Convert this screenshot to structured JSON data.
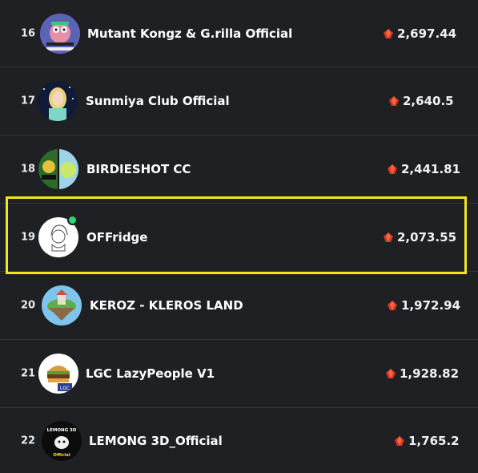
{
  "colors": {
    "background": "#1f2024",
    "divider": "#34363c",
    "highlight": "#f5e61c",
    "online": "#2fd673",
    "volume_icon": "#d9342b"
  },
  "volume_icon": "red-gem-icon",
  "rows": [
    {
      "rank": "16",
      "name": "Mutant Kongz & G.rilla Official",
      "volume": "2,697.44",
      "avatar": "mutant-kongz-avatar"
    },
    {
      "rank": "17",
      "name": "Sunmiya Club Official",
      "volume": "2,640.5",
      "avatar": "sunmiya-avatar"
    },
    {
      "rank": "18",
      "name": "BIRDIESHOT CC",
      "volume": "2,441.81",
      "avatar": "birdieshot-avatar"
    },
    {
      "rank": "19",
      "name": "OFFridge",
      "volume": "2,073.55",
      "avatar": "offridge-avatar"
    },
    {
      "rank": "20",
      "name": "KEROZ - KLEROS LAND",
      "volume": "1,972.94",
      "avatar": "keroz-avatar"
    },
    {
      "rank": "21",
      "name": "LGC LazyPeople V1",
      "volume": "1,928.82",
      "avatar": "lgc-avatar",
      "avatar_badge": "LGC"
    },
    {
      "rank": "22",
      "name": "LEMONG 3D_Official",
      "volume": "1,765.2",
      "avatar": "lemong-avatar",
      "avatar_text": [
        "LEMONG 3D",
        "Official"
      ]
    }
  ]
}
